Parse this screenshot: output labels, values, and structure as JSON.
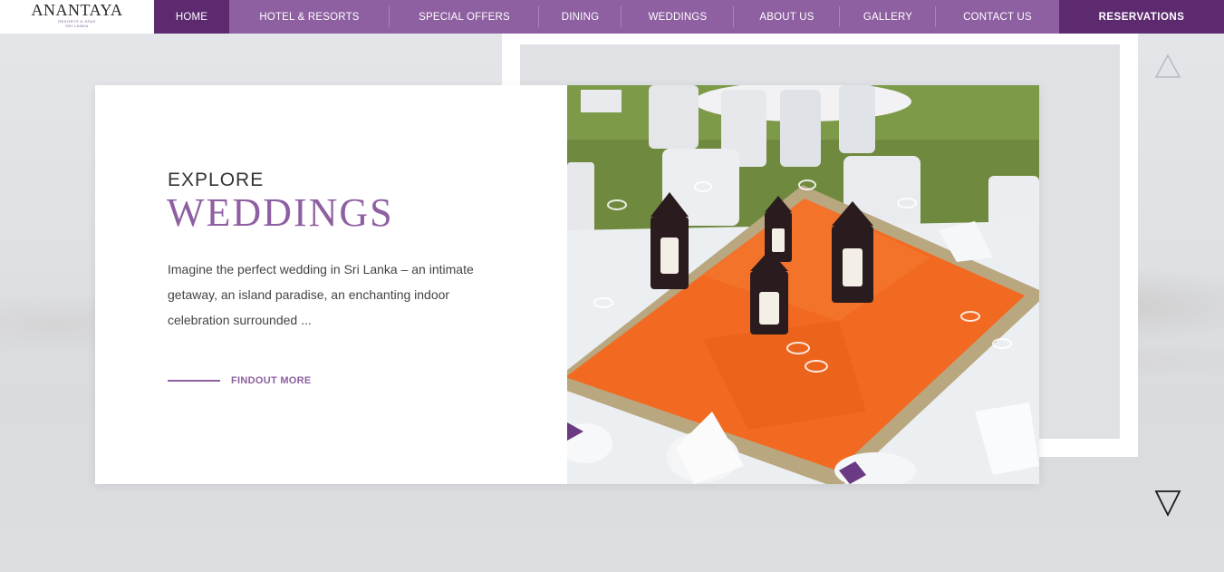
{
  "brand": {
    "name": "ANANTAYA",
    "tagline": "RESORTS & SPAS",
    "location": "SRI LANKA"
  },
  "nav": {
    "items": [
      {
        "label": "HOME",
        "active": true
      },
      {
        "label": "HOTEL & RESORTS",
        "active": false
      },
      {
        "label": "SPECIAL OFFERS",
        "active": false
      },
      {
        "label": "DINING",
        "active": false
      },
      {
        "label": "WEDDINGS",
        "active": false
      },
      {
        "label": "ABOUT US",
        "active": false
      },
      {
        "label": "GALLERY",
        "active": false
      },
      {
        "label": "CONTACT US",
        "active": false
      }
    ],
    "reservations_label": "RESERVATIONS"
  },
  "hero": {
    "eyebrow": "EXPLORE",
    "title": "WEDDINGS",
    "description": "Imagine the perfect wedding in Sri Lanka – an intimate getaway, an island paradise, an enchanting indoor celebration surrounded ...",
    "cta_label": "FINDOUT MORE"
  },
  "icons": {
    "prev": "triangle-up-icon",
    "next": "triangle-down-icon"
  },
  "colors": {
    "accent": "#8e5fa1",
    "accent_dark": "#5d2a70",
    "tablecloth": "#f26a21"
  }
}
